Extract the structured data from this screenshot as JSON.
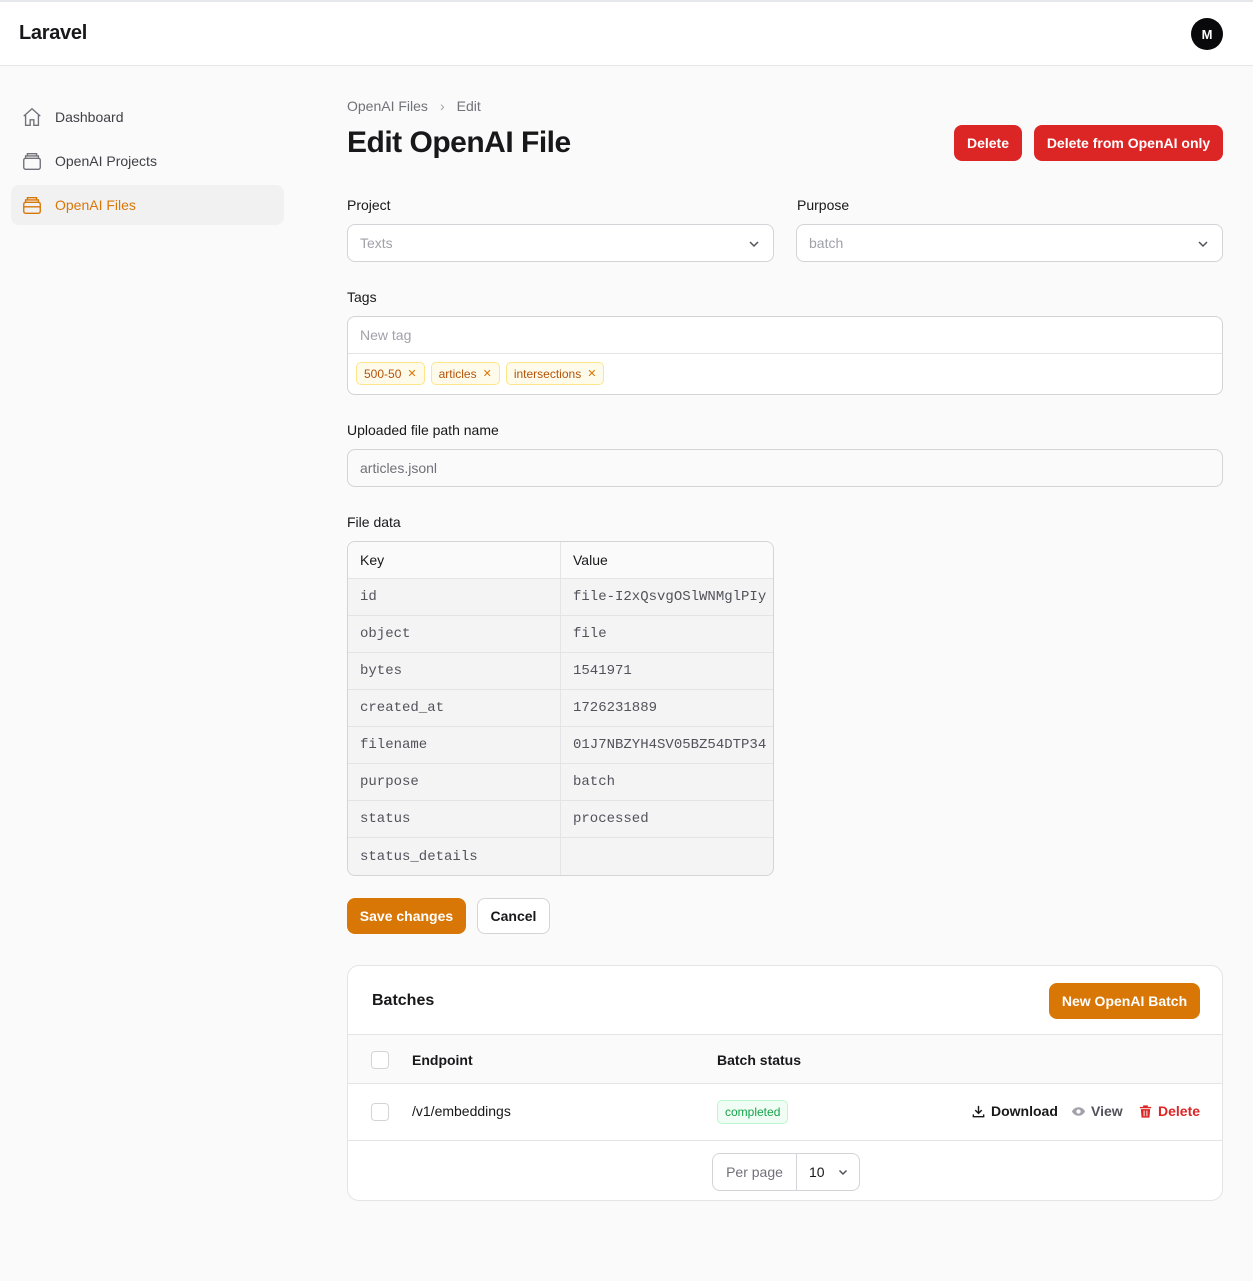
{
  "app": {
    "brand": "Laravel",
    "avatar_initial": "M"
  },
  "nav": {
    "items": [
      {
        "label": "Dashboard",
        "icon": "home-icon",
        "active": false
      },
      {
        "label": "OpenAI Projects",
        "icon": "archive-icon",
        "active": false
      },
      {
        "label": "OpenAI Files",
        "icon": "archive-icon",
        "active": true
      }
    ]
  },
  "breadcrumb": {
    "parent": "OpenAI Files",
    "current": "Edit"
  },
  "page": {
    "title": "Edit OpenAI File"
  },
  "actions": {
    "delete": "Delete",
    "delete_openai": "Delete from OpenAI only"
  },
  "form": {
    "project": {
      "label": "Project",
      "value": "Texts"
    },
    "purpose": {
      "label": "Purpose",
      "value": "batch"
    },
    "tags": {
      "label": "Tags",
      "placeholder": "New tag",
      "items": [
        "500-50",
        "articles",
        "intersections"
      ]
    },
    "path": {
      "label": "Uploaded file path name",
      "value": "articles.jsonl"
    },
    "file_data": {
      "label": "File data",
      "key_header": "Key",
      "value_header": "Value",
      "rows": [
        {
          "key": "id",
          "value": "file-I2xQsvgOSlWNMglPIy"
        },
        {
          "key": "object",
          "value": "file"
        },
        {
          "key": "bytes",
          "value": "1541971"
        },
        {
          "key": "created_at",
          "value": "1726231889"
        },
        {
          "key": "filename",
          "value": "01J7NBZYH4SV05BZ54DTP34"
        },
        {
          "key": "purpose",
          "value": "batch"
        },
        {
          "key": "status",
          "value": "processed"
        },
        {
          "key": "status_details",
          "value": ""
        }
      ]
    },
    "save": "Save changes",
    "cancel": "Cancel"
  },
  "batches": {
    "title": "Batches",
    "new_button": "New OpenAI Batch",
    "columns": {
      "endpoint": "Endpoint",
      "status": "Batch status"
    },
    "rows": [
      {
        "endpoint": "/v1/embeddings",
        "status": "completed",
        "download": "Download",
        "view": "View",
        "delete": "Delete"
      }
    ],
    "per_page_label": "Per page",
    "per_page_value": "10"
  },
  "colors": {
    "accent": "#d97706",
    "danger": "#dc2626",
    "success": "#16a34a"
  }
}
